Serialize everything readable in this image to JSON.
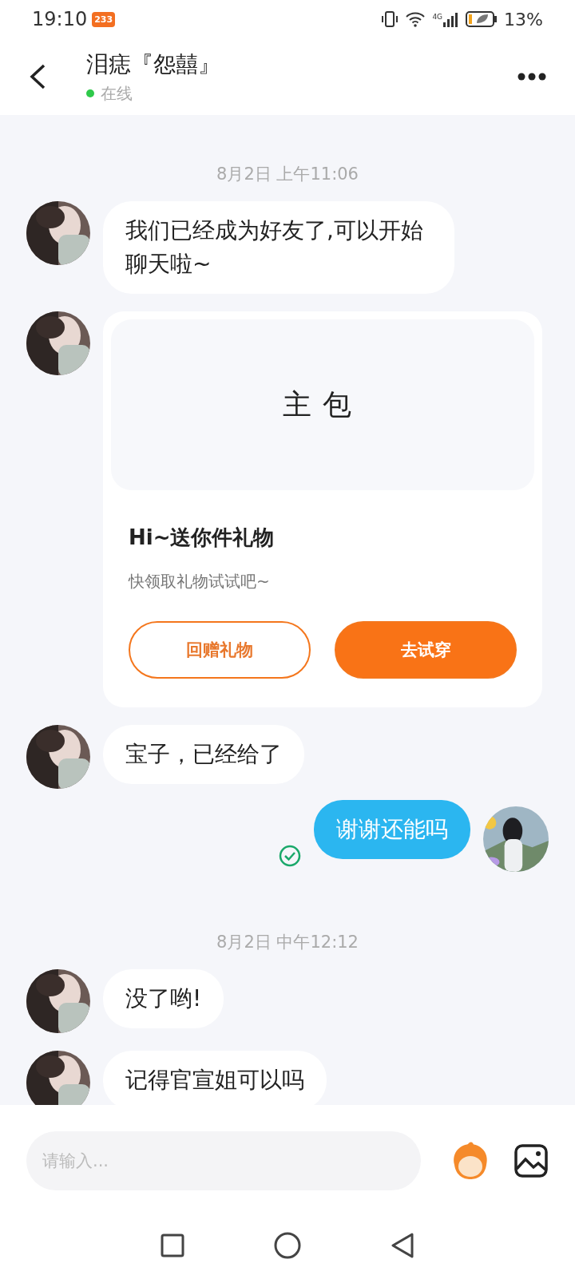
{
  "status_bar": {
    "time": "19:10",
    "badge": "233",
    "network": "4G",
    "battery": "13%"
  },
  "header": {
    "title": "泪痣『怨囍』",
    "online": true,
    "status": "在线"
  },
  "messages": [
    {
      "kind": "time",
      "text": "8月2日 上午11:06"
    },
    {
      "kind": "text",
      "outgoing": false,
      "text": "我们已经成为好友了,可以开始聊天啦~"
    },
    {
      "kind": "gift",
      "outgoing": false,
      "preview": "主包",
      "title": "Hi~送你件礼物",
      "subtitle": "快领取礼物试试吧~",
      "buttons": [
        {
          "label": "回赠礼物",
          "primary": false
        },
        {
          "label": "去试穿",
          "primary": true
        }
      ]
    },
    {
      "kind": "text",
      "outgoing": false,
      "text": "宝子，已经给了"
    },
    {
      "kind": "text",
      "outgoing": true,
      "text": "谢谢还能吗",
      "read": true
    },
    {
      "kind": "time",
      "text": "8月2日 中午12:12"
    },
    {
      "kind": "text",
      "outgoing": false,
      "text": "没了哟!"
    },
    {
      "kind": "text",
      "outgoing": false,
      "text": "记得官宣姐可以吗"
    }
  ],
  "composer": {
    "placeholder": "请输入..."
  }
}
